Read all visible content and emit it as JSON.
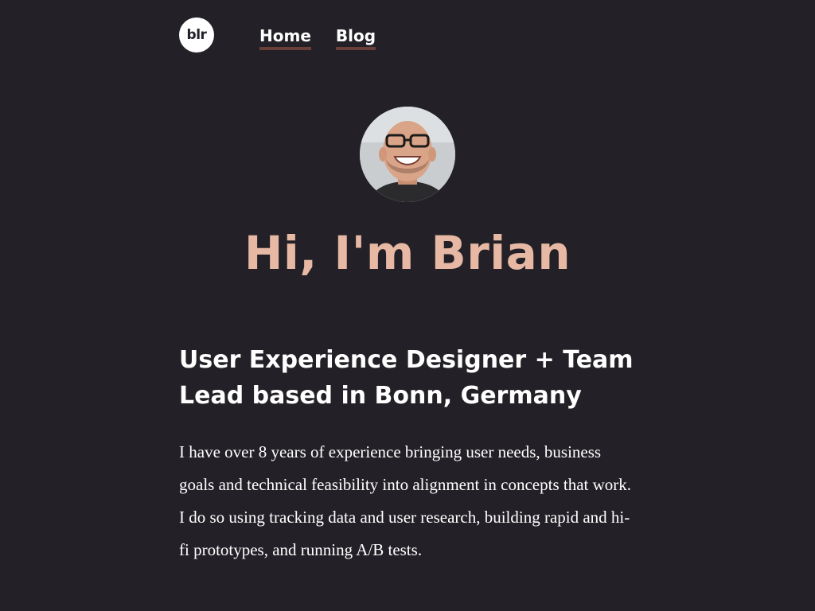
{
  "header": {
    "logo_text": "blr",
    "nav": [
      {
        "label": "Home"
      },
      {
        "label": "Blog"
      }
    ]
  },
  "hero": {
    "greeting": "Hi, I'm Brian",
    "avatar_alt_icon": "profile-photo"
  },
  "about": {
    "subtitle": "User Experience Designer + Team Lead based in Bonn, Germany",
    "intro": "I have over 8 years of experience bringing user needs, business goals and technical feasibility into alignment in concepts that work. I do so using tracking data and user research, building rapid and hi-fi prototypes, and running A/B tests."
  },
  "colors": {
    "background": "#232127",
    "accent": "#e7b8a3",
    "nav_underline": "#6b3f39",
    "text": "#ffffff"
  }
}
